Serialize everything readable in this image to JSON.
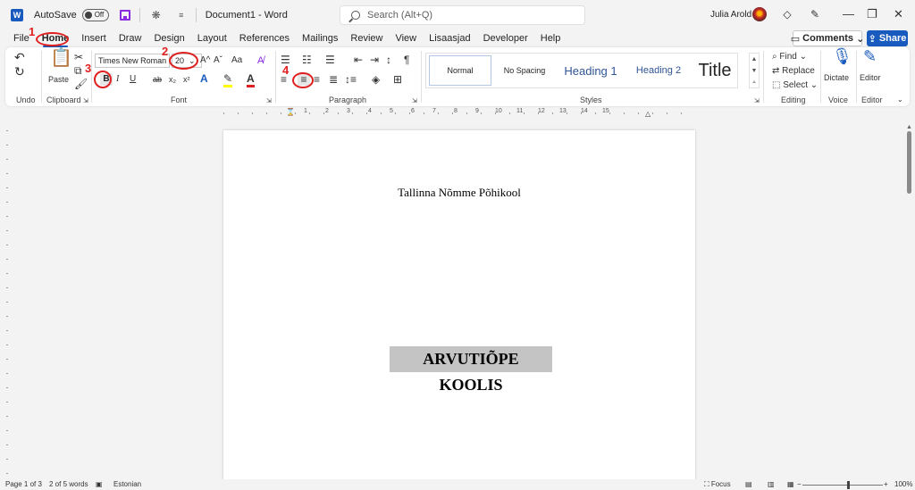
{
  "titlebar": {
    "autosave_label": "AutoSave",
    "autosave_state": "Off",
    "doc_title": "Document1  -  Word",
    "search_placeholder": "Search (Alt+Q)",
    "user_name": "Julia Arold",
    "word_logo": "W"
  },
  "tabs": [
    "File",
    "Home",
    "Insert",
    "Draw",
    "Design",
    "Layout",
    "References",
    "Mailings",
    "Review",
    "View",
    "Lisaasjad",
    "Developer",
    "Help"
  ],
  "active_tab": "Home",
  "comments_label": "Comments",
  "share_label": "Share",
  "ribbon": {
    "groups": {
      "undo": "Undo",
      "clipboard": "Clipboard",
      "font": "Font",
      "paragraph": "Paragraph",
      "styles": "Styles",
      "editing": "Editing",
      "voice": "Voice",
      "editor": "Editor"
    },
    "paste_label": "Paste",
    "font_name": "Times New Roman",
    "font_size": "20",
    "bold": "B",
    "italic": "I",
    "underline": "U",
    "strike": "ab",
    "subscript": "x₂",
    "superscript": "x²",
    "change_case": "Aa",
    "grow_font": "A^",
    "shrink_font": "Aˇ",
    "styles": [
      "Normal",
      "No Spacing",
      "Heading 1",
      "Heading 2",
      "Title"
    ],
    "find_label": "Find",
    "replace_label": "Replace",
    "select_label": "Select",
    "dictate_label": "Dictate",
    "editor_label": "Editor"
  },
  "annotations": [
    "1",
    "2",
    "3",
    "4"
  ],
  "ruler_numbers": [
    "1",
    "2",
    "3",
    "4",
    "5",
    "6",
    "7",
    "8",
    "9",
    "10",
    "11",
    "12",
    "13",
    "14",
    "15"
  ],
  "document": {
    "school": "Tallinna Nõmme Põhikool",
    "title": "ARVUTIÕPE KOOLIS"
  },
  "statusbar": {
    "page": "Page 1 of 3",
    "words": "2 of 5 words",
    "language": "Estonian",
    "focus": "Focus",
    "zoom": "100%"
  },
  "colors": {
    "accent": "#185abd",
    "annotation": "#e02020",
    "highlight": "#ffff00",
    "font_color": "#e02020"
  }
}
